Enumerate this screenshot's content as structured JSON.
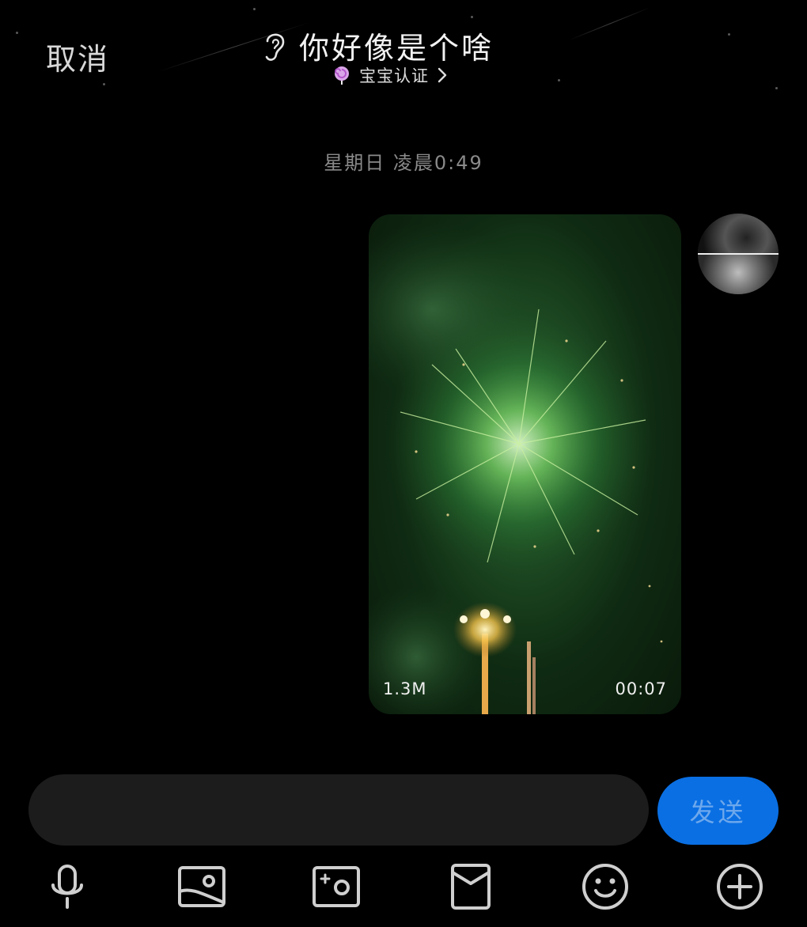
{
  "header": {
    "cancel_label": "取消",
    "title": "你好像是个啥",
    "subtitle": "宝宝认证"
  },
  "chat": {
    "timestamp": "星期日 凌晨0:49",
    "video": {
      "size": "1.3M",
      "duration": "00:07"
    }
  },
  "composer": {
    "input_value": "",
    "send_label": "发送"
  },
  "toolbar": {
    "icons": [
      "microphone-icon",
      "image-icon",
      "camera-icon",
      "red-packet-icon",
      "emoji-icon",
      "plus-icon"
    ]
  },
  "colors": {
    "background": "#000000",
    "send_button": "#0a6fe3",
    "input_bg": "#1c1c1c"
  }
}
